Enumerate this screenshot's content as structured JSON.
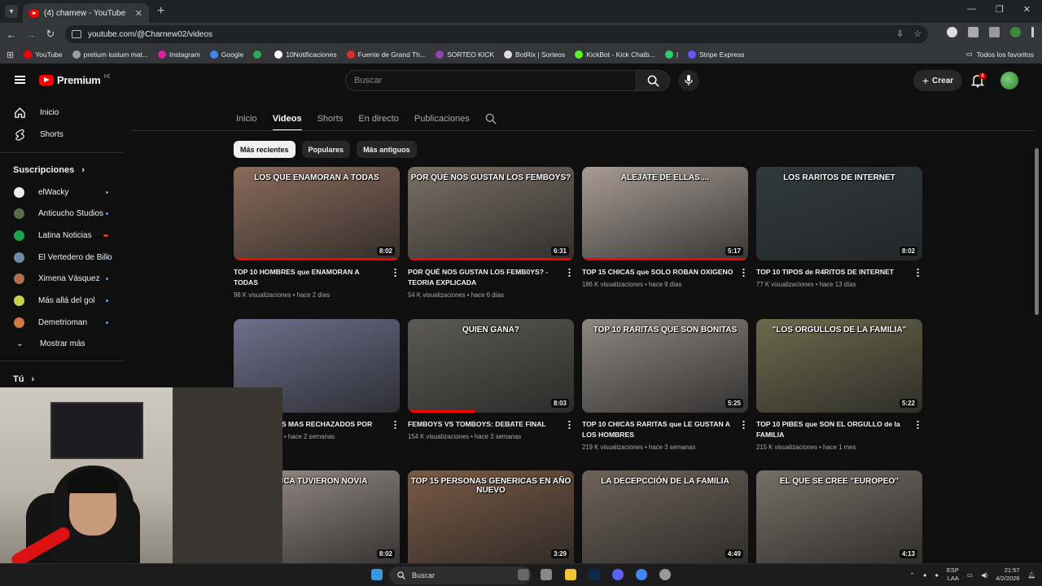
{
  "browser": {
    "tab_title": "(4) chamew - YouTube",
    "url": "youtube.com/@Charnew02/videos",
    "bookmarks": [
      {
        "label": "YouTube",
        "color": "#ff0000"
      },
      {
        "label": "pretium iustum mat...",
        "color": "#9aa0a6"
      },
      {
        "label": "Instagram",
        "color": "#d6249f"
      },
      {
        "label": "Google",
        "color": "#4285f4"
      },
      {
        "label": "",
        "color": "#34a853"
      },
      {
        "label": "10Notificaciones",
        "color": "#ffffff"
      },
      {
        "label": "Fuente de Grand Th...",
        "color": "#d93025"
      },
      {
        "label": "SORTEO KICK",
        "color": "#8e44ad"
      },
      {
        "label": "BotRix | Sorteos",
        "color": "#dddddd"
      },
      {
        "label": "KickBot - Kick Chatb...",
        "color": "#53fc18"
      },
      {
        "label": "|",
        "color": "#25d366"
      },
      {
        "label": "Stripe Express",
        "color": "#635bff"
      }
    ],
    "all_bookmarks": "Todos los favoritos"
  },
  "masthead": {
    "logo": "Premium",
    "region": "PE",
    "search_placeholder": "Buscar",
    "create_label": "Crear",
    "notifications": "4"
  },
  "sidebar": {
    "home": "Inicio",
    "shorts": "Shorts",
    "subscriptions_title": "Suscripciones",
    "subs": [
      {
        "name": "elWacky",
        "color": "#eeeeee"
      },
      {
        "name": "Anticucho Studios",
        "color": "#5a6b4a"
      },
      {
        "name": "Latina Noticias",
        "color": "#1fa34a"
      },
      {
        "name": "El Vertedero de Billo",
        "color": "#6f8aa7"
      },
      {
        "name": "Ximena Vásquez",
        "color": "#b07050"
      },
      {
        "name": "Más allá del gol",
        "color": "#c7d24a"
      },
      {
        "name": "Demetrioman",
        "color": "#d07a4a"
      }
    ],
    "show_more": "Mostrar más",
    "you": "Tú"
  },
  "channel_tabs": [
    "Inicio",
    "Videos",
    "Shorts",
    "En directo",
    "Publicaciones"
  ],
  "chips": [
    "Más recientes",
    "Populares",
    "Más antiguos"
  ],
  "videos": [
    {
      "caption": "LOS QUE ENAMORAN A TODAS",
      "duration": "8:02",
      "title": "TOP 10 HOMBRES que ENAMORAN A TODAS",
      "meta": "98 K visualizaciones • hace 2 días",
      "bg": "#8b6b5a",
      "progress": 1.0
    },
    {
      "caption": "POR QUÉ NOS GUSTAN LOS FEMBOYS?",
      "duration": "6:31",
      "title": "POR QUÉ NOS GUSTAN LOS FEMB0YS? - TEORIA EXPLICADA",
      "meta": "54 K visualizaciones • hace 6 días",
      "bg": "#7a6f63",
      "progress": 1.0
    },
    {
      "caption": "ALEJATE DE ELLAS....",
      "duration": "5:17",
      "title": "TOP 15 CHICAS que SOLO ROBAN OXIGENO",
      "meta": "186 K visualizaciones • hace 9 días",
      "bg": "#a89c93",
      "progress": 1.0
    },
    {
      "caption": "LOS RARITOS DE INTERNET",
      "duration": "8:02",
      "title": "TOP 10 TIPOS de R4RITOS DE INTERNET",
      "meta": "77 K visualizaciones • hace 13 días",
      "bg": "#2f3a3f",
      "progress": 0
    },
    {
      "caption": "",
      "duration": "",
      "title": "TOP 10 CHICAS MAS RECHAZADOS POR",
      "meta": "K visualizaciones • hace 2 semanas",
      "bg": "#6d6f8c",
      "progress": 0
    },
    {
      "caption": "QUIEN GANA?",
      "duration": "8:03",
      "title": "FEMBOYS VS TOMBOYS: DEBATE FINAL",
      "meta": "154 K visualizaciones • hace 3 semanas",
      "bg": "#5b5a55",
      "progress": 0.4
    },
    {
      "caption": "TOP 10 RARITAS QUE SON BONITAS",
      "duration": "5:25",
      "title": "TOP 10 CHICAS RARITAS que LE GUSTAN A LOS HOMBRES",
      "meta": "219 K visualizaciones • hace 3 semanas",
      "bg": "#8d8680",
      "progress": 0
    },
    {
      "caption": "\"LOS ORGULLOS DE LA FAMILIA\"",
      "duration": "5:22",
      "title": "TOP 10 PIBES que SON EL ORGULLO de la FAMILIA",
      "meta": "215 K visualizaciones • hace 1 mes",
      "bg": "#6c6a4b",
      "progress": 0
    },
    {
      "caption": "NUNCA TUVIERON NOVIA",
      "duration": "8:02",
      "title": "",
      "meta": "",
      "bg": "#9b8f88",
      "progress": 0
    },
    {
      "caption": "TOP 15 PERSONAS GENERICAS EN AÑO NUEVO",
      "duration": "3:29",
      "title": "",
      "meta": "",
      "bg": "#7a5a45",
      "progress": 0
    },
    {
      "caption": "LA DECEPCCIÓN DE LA FAMILIA",
      "duration": "4:49",
      "title": "",
      "meta": "",
      "bg": "#6e6358",
      "progress": 0
    },
    {
      "caption": "EL QUE SE CREE \"EUROPEO\"",
      "duration": "4:13",
      "title": "",
      "meta": "",
      "bg": "#757065",
      "progress": 0
    }
  ],
  "taskbar": {
    "search": "Buscar",
    "lang": "ESP",
    "lang2": "LAA",
    "time": "21:57",
    "date": "4/2/2026"
  }
}
